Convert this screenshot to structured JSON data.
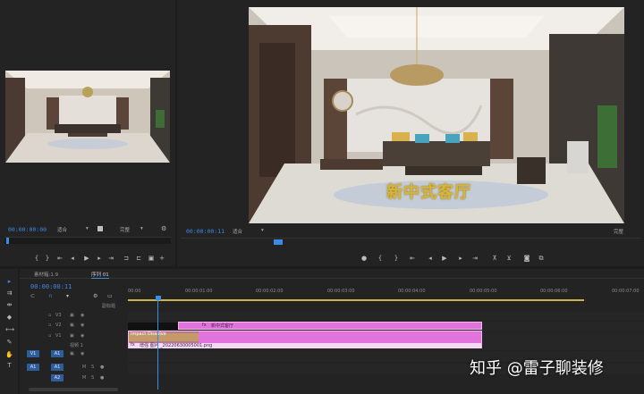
{
  "source": {
    "timecode": "00:00:00:00",
    "fit": "适合",
    "quality": "完整"
  },
  "program": {
    "timecode": "00:00:00:11",
    "fit": "适合",
    "quality": "完整",
    "overlay_title": "新中式客厅"
  },
  "timeline": {
    "tabs": [
      "素材箱:1.9",
      "序列 01"
    ],
    "timecode": "00:00:00:11",
    "ruler_labels": [
      "00:00",
      "00:00:01:00",
      "00:00:02:00",
      "00:00:03:00",
      "00:00:04:00",
      "00:00:05:00",
      "00:00:06:00",
      "00:00:07:00"
    ],
    "tracks": {
      "v3": "V3",
      "v2": "V2",
      "v1": "V1",
      "a1": "A1",
      "a2": "A2",
      "src_v1": "V1",
      "src_a1": "A1",
      "v1_name": "视频 1",
      "header_label": "副标题"
    },
    "clips": {
      "title_clip": "新中式客厅",
      "transition": "Impact Dissolve",
      "image_clip": "增强 图片 _20220630005001.png",
      "fx": "fx"
    }
  },
  "watermark": "知乎 @雷子聊装修",
  "colors": {
    "accent_blue": "#3d8be6",
    "clip_pink": "#e173dc",
    "title_gold": "#d9b537",
    "panel": "#232323"
  }
}
